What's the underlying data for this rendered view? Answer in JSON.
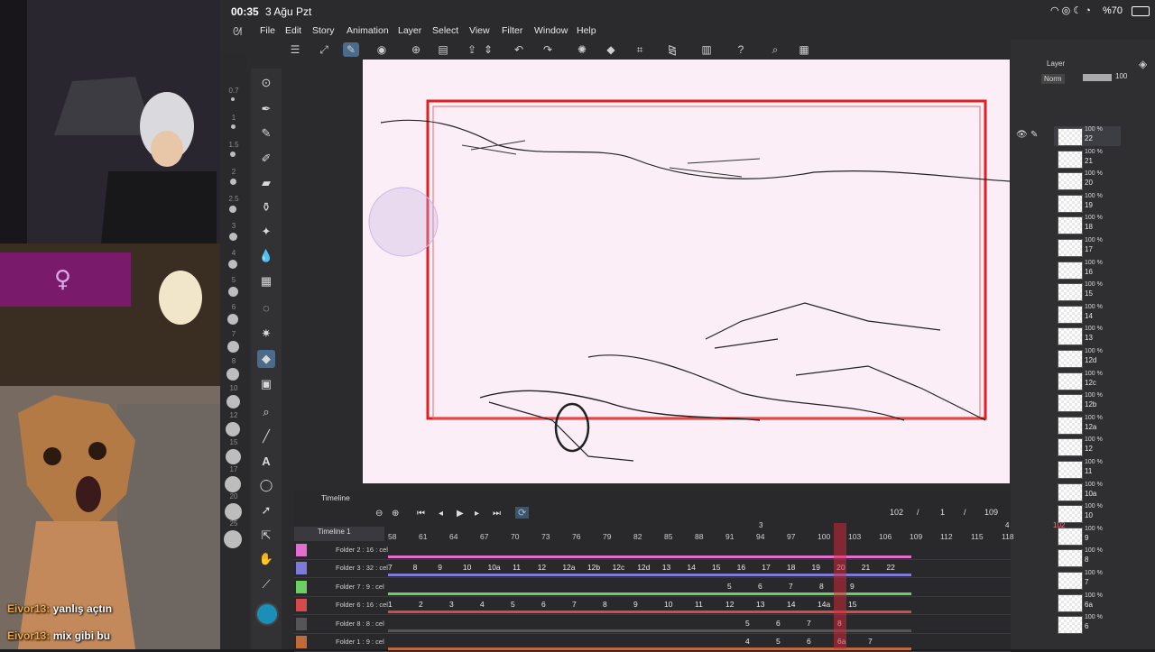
{
  "status": {
    "time": "00:35",
    "date": "3 Ağu Pzt",
    "battery": "%70"
  },
  "menu": [
    "File",
    "Edit",
    "Story",
    "Animation",
    "Layer",
    "Select",
    "View",
    "Filter",
    "Window",
    "Help"
  ],
  "chat": [
    {
      "user": "Eivor13:",
      "msg": "yanlış açtın"
    },
    {
      "user": "Eivor13:",
      "msg": "mix gibi bu"
    }
  ],
  "sizebar": [
    "0.7",
    "1",
    "1.5",
    "2",
    "2.5",
    "3",
    "4",
    "5",
    "6",
    "7",
    "8",
    "10",
    "12",
    "15",
    "17",
    "20",
    "25"
  ],
  "layers_panel": {
    "tab": "Layer",
    "blend": "Norm",
    "opacity": "100",
    "layers": [
      {
        "pct": "100 %",
        "name": "22"
      },
      {
        "pct": "100 %",
        "name": "21"
      },
      {
        "pct": "100 %",
        "name": "20"
      },
      {
        "pct": "100 %",
        "name": "19"
      },
      {
        "pct": "100 %",
        "name": "18"
      },
      {
        "pct": "100 %",
        "name": "17"
      },
      {
        "pct": "100 %",
        "name": "16"
      },
      {
        "pct": "100 %",
        "name": "15"
      },
      {
        "pct": "100 %",
        "name": "14"
      },
      {
        "pct": "100 %",
        "name": "13"
      },
      {
        "pct": "100 %",
        "name": "12d"
      },
      {
        "pct": "100 %",
        "name": "12c"
      },
      {
        "pct": "100 %",
        "name": "12b"
      },
      {
        "pct": "100 %",
        "name": "12a"
      },
      {
        "pct": "100 %",
        "name": "12"
      },
      {
        "pct": "100 %",
        "name": "11"
      },
      {
        "pct": "100 %",
        "name": "10a"
      },
      {
        "pct": "100 %",
        "name": "10"
      },
      {
        "pct": "100 %",
        "name": "9"
      },
      {
        "pct": "100 %",
        "name": "8"
      },
      {
        "pct": "100 %",
        "name": "7"
      },
      {
        "pct": "100 %",
        "name": "6a"
      },
      {
        "pct": "100 %",
        "name": "6"
      }
    ]
  },
  "timeline": {
    "title": "Timeline",
    "name": "Timeline 1",
    "current_frame": "102",
    "sep1": "/",
    "step": "1",
    "sep2": "/",
    "total": "109",
    "playhead": "102",
    "markers": [
      "3",
      "4"
    ],
    "ruler": [
      "58",
      "61",
      "64",
      "67",
      "70",
      "73",
      "76",
      "79",
      "82",
      "85",
      "88",
      "91",
      "94",
      "97",
      "100",
      "103",
      "106",
      "109",
      "112",
      "115",
      "118"
    ],
    "tracks": [
      {
        "label": "Folder 2 : 16 : cel",
        "color": "#e26fcf",
        "frames": []
      },
      {
        "label": "Folder 3 : 32 : cel",
        "color": "#7e7ad8",
        "frames": [
          "7",
          "8",
          "9",
          "10",
          "10a",
          "11",
          "12",
          "12a",
          "12b",
          "12c",
          "12d",
          "13",
          "14",
          "15",
          "16",
          "17",
          "18",
          "19",
          "20",
          "21",
          "22"
        ]
      },
      {
        "label": "Folder 7 : 9 : cel",
        "color": "#6bcf63",
        "frames": [
          "5",
          "6",
          "7",
          "8",
          "9"
        ]
      },
      {
        "label": "Folder 6 : 16 : cel",
        "color": "#d84a4a",
        "frames": [
          "1",
          "2",
          "3",
          "4",
          "5",
          "6",
          "7",
          "8",
          "9",
          "10",
          "11",
          "12",
          "13",
          "14",
          "14a",
          "15"
        ]
      },
      {
        "label": "Folder 8 : 8 : cel",
        "color": "#555",
        "frames": [
          "5",
          "6",
          "7",
          "8"
        ]
      },
      {
        "label": "Folder 1 : 9 : cel",
        "color": "#c06a3a",
        "frames": [
          "4",
          "5",
          "6",
          "6a",
          "7"
        ]
      }
    ]
  }
}
